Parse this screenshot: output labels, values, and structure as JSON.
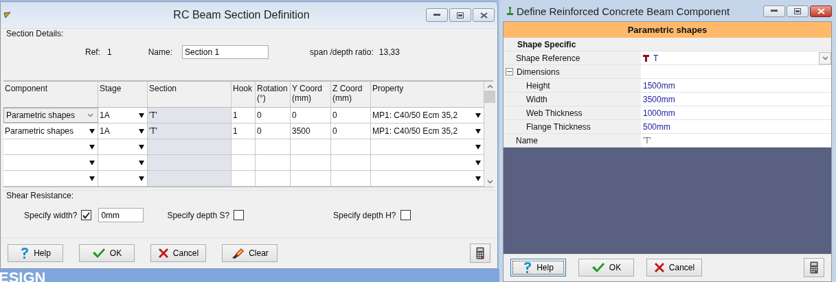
{
  "left_window": {
    "title": "RC Beam Section Definition",
    "section_details": {
      "legend": "Section Details:",
      "ref_label": "Ref:",
      "ref_value": "1",
      "name_label": "Name:",
      "name_value": "Section 1",
      "ratio_label": "span /depth ratio:",
      "ratio_value": "13,33"
    },
    "table": {
      "columns": [
        "Component",
        "Stage",
        "Section",
        "Hook",
        "Rotation (°)",
        "Y Coord (mm)",
        "Z Coord (mm)",
        "Property"
      ],
      "rows": [
        {
          "editing": true,
          "cells": [
            "Parametric shapes",
            "1A",
            "'T'",
            "1",
            "0",
            "0",
            "0",
            "MP1: C40/50 Ecm 35,2"
          ]
        },
        {
          "editing": false,
          "cells": [
            "Parametric shapes",
            "1A",
            "'T'",
            "1",
            "0",
            "3500",
            "0",
            "MP1: C40/50 Ecm 35,2"
          ]
        },
        {
          "editing": false
        },
        {
          "editing": false
        },
        {
          "editing": false
        }
      ]
    },
    "shear": {
      "legend": "Shear Resistance:",
      "options": [
        {
          "label": "Specify width?",
          "checked": true,
          "value": "0mm"
        },
        {
          "label": "Specify depth S?",
          "checked": false
        },
        {
          "label": "Specify depth H?",
          "checked": false
        }
      ]
    },
    "buttons": [
      {
        "kind": "help",
        "label": "Help"
      },
      {
        "kind": "ok",
        "label": "OK"
      },
      {
        "kind": "cancel",
        "label": "Cancel"
      },
      {
        "kind": "clear",
        "label": "Clear"
      },
      {
        "kind": "calculator"
      }
    ]
  },
  "background_text": "ESIGN",
  "right_window": {
    "title": "Define Reinforced Concrete Beam Component",
    "header": "Parametric shapes",
    "properties": [
      {
        "kind": "category",
        "label": "Shape Specific"
      },
      {
        "kind": "shape",
        "label": "Shape Reference",
        "value": "T"
      },
      {
        "kind": "group",
        "label": "Dimensions",
        "expanded": true,
        "children": [
          {
            "label": "Height",
            "value": "1500mm"
          },
          {
            "label": "Width",
            "value": "3500mm"
          },
          {
            "label": "Web Thickness",
            "value": "1000mm"
          },
          {
            "label": "Flange Thickness",
            "value": "500mm"
          }
        ]
      },
      {
        "kind": "text",
        "label": "Name",
        "value": "'T'"
      }
    ],
    "buttons": [
      {
        "kind": "help",
        "label": "Help",
        "focused": true
      },
      {
        "kind": "ok",
        "label": "OK",
        "focused": false
      },
      {
        "kind": "cancel",
        "label": "Cancel",
        "focused": false
      },
      {
        "kind": "calculator",
        "focused": false
      }
    ]
  }
}
